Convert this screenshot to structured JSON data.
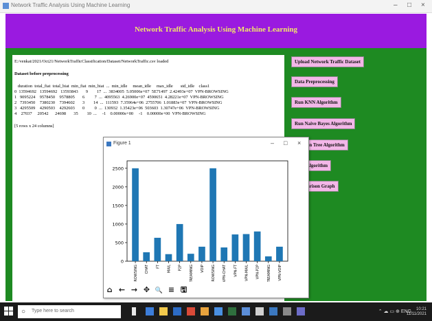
{
  "window": {
    "title": "Network Traffic Analysis Using Machine Learning",
    "controls": [
      "–",
      "□",
      "×"
    ]
  },
  "header": {
    "title": "Network Traffic Analysis Using Machine Learning"
  },
  "output": {
    "lines": [
      "E:/venkat/2021/Oct21/NetworkTrafficClassification/Dataset/NetworkTraffic.csv loaded",
      "",
      "Dataset before preprocessing",
      "",
      "   duration  total_fiat  total_biat  min_fiat  min_biat  ...  min_idle     mean_idle     max_idle       std_idle    class1",
      "0  13594692   13594692   13593843       9        17  ...  3834005  5.05006e+07  5E71497  2.42493e+07  VPN-BROWSING",
      "1   9095224    9578450    9578805       6         7  ...  4095563  4.26900e+07  4590651  4.28221e+07  VPN-BROWSING",
      "2   7393450    7380230    7394602       3        14  ...  111593  7.35964e+06  2755706  1.01883e+07  VPN-BROWSING",
      "3   4295509    4290503    4292603       0         0  ...  130932  1.35423e+06  503603  1.30747e+06  VPN-BROWSING",
      "4    27037     20542      24698       35        10  ...     -1    0.00000e+00     -1    0.00000e+00  VPN-BROWSING",
      "",
      "[5 rows x 24 columns]"
    ]
  },
  "buttons": [
    "Upload Network Traffic Dataset",
    "Data Preprocessing",
    "Run KNN Algorithm",
    "Run Naive Bayes Algorithm",
    "Decision Tree Algorithm",
    "SVM Algorithm",
    "Comparison Graph"
  ],
  "figure_window": {
    "title": "Figure 1",
    "controls": [
      "–",
      "□",
      "×"
    ]
  },
  "chart_data": {
    "type": "bar",
    "categories": [
      "BROWSING",
      "CHAT",
      "FT",
      "MAIL",
      "P2P",
      "STREAMING",
      "VOIP",
      "VPN-BROWSING",
      "VPN-CHAT",
      "VPN-FT",
      "VPN-MAIL",
      "VPN-P2P",
      "VPN-STREAMING",
      "VPN-VOIP"
    ],
    "values": [
      2500,
      240,
      630,
      190,
      1000,
      200,
      390,
      2500,
      370,
      720,
      730,
      800,
      130,
      390
    ],
    "ylim": [
      0,
      2700
    ],
    "yticks": [
      0,
      500,
      1000,
      1500,
      2000,
      2500
    ],
    "bar_color": "#1f77b4"
  },
  "toolbar": {
    "icons": [
      "home-icon",
      "back-icon",
      "forward-icon",
      "pan-icon",
      "zoom-icon",
      "configure-icon",
      "save-icon"
    ],
    "glyphs": [
      "⌂",
      "←",
      "→",
      "✥",
      "🔍",
      "≡",
      "🖫"
    ]
  },
  "taskbar": {
    "search_placeholder": "Type here to search",
    "clock_time": "10:21",
    "clock_date": "11/11/2021"
  },
  "colors": {
    "header": "#9a1ae0",
    "header_text": "#f2e86a",
    "background": "#1e8a22",
    "button": "#f3b7e8"
  }
}
